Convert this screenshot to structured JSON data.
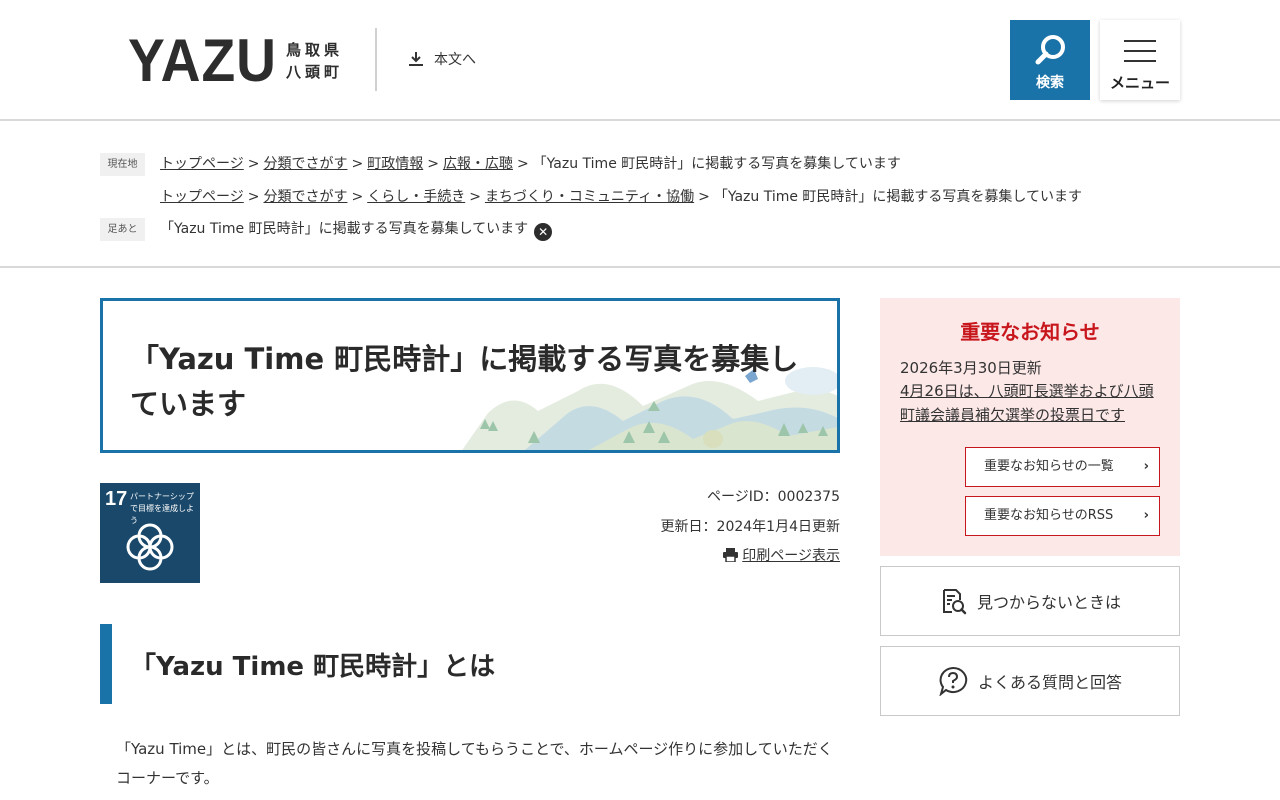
{
  "header": {
    "logo_main": "YAZU",
    "logo_sub_line1": "鳥取県",
    "logo_sub_line2": "八頭町",
    "skip_label": "本文へ",
    "search_label": "検索",
    "menu_label": "メニュー"
  },
  "breadcrumbs": {
    "current_tag": "現在地",
    "footprint_tag": "足あと",
    "trail1": [
      "トップページ",
      "分類でさがす",
      "町政情報",
      "広報・広聴"
    ],
    "trail1_current": "「Yazu Time 町民時計」に掲載する写真を募集しています",
    "trail2": [
      "トップページ",
      "分類でさがす",
      "くらし・手続き",
      "まちづくり・コミュニティ・協働"
    ],
    "trail2_current": "「Yazu Time 町民時計」に掲載する写真を募集しています",
    "footprint_item": "「Yazu Time 町民時計」に掲載する写真を募集しています",
    "separator": ">"
  },
  "page": {
    "title": "「Yazu Time 町民時計」に掲載する写真を募集しています",
    "sdg_number": "17",
    "sdg_text": "パートナーシップで目標を達成しよう",
    "page_id": "ページID：0002375",
    "updated": "更新日：2024年1月4日更新",
    "print_label": "印刷ページ表示",
    "section_heading": "「Yazu Time 町民時計」とは",
    "body": "「Yazu Time」とは、町民の皆さんに写真を投稿してもらうことで、ホームページ作りに参加していただくコーナーです。"
  },
  "sidebar": {
    "notice_heading": "重要なお知らせ",
    "notice_date": "2026年3月30日更新",
    "notice_link": "4月26日は、八頭町長選挙および八頭町議会議員補欠選挙の投票日です",
    "notice_list_button": "重要なお知らせの一覧",
    "notice_rss_button": "重要なお知らせのRSS",
    "not_found_label": "見つからないときは",
    "faq_label": "よくある質問と回答"
  },
  "colors": {
    "accent_blue": "#1a73a8",
    "notice_red": "#c8161d",
    "notice_bg": "#fde8e8",
    "sdg_navy": "#19486a"
  },
  "icons": [
    "download-icon",
    "search-icon",
    "hamburger-icon",
    "close-icon",
    "printer-icon",
    "chevron-right-icon",
    "document-search-icon",
    "question-bubble-icon"
  ]
}
